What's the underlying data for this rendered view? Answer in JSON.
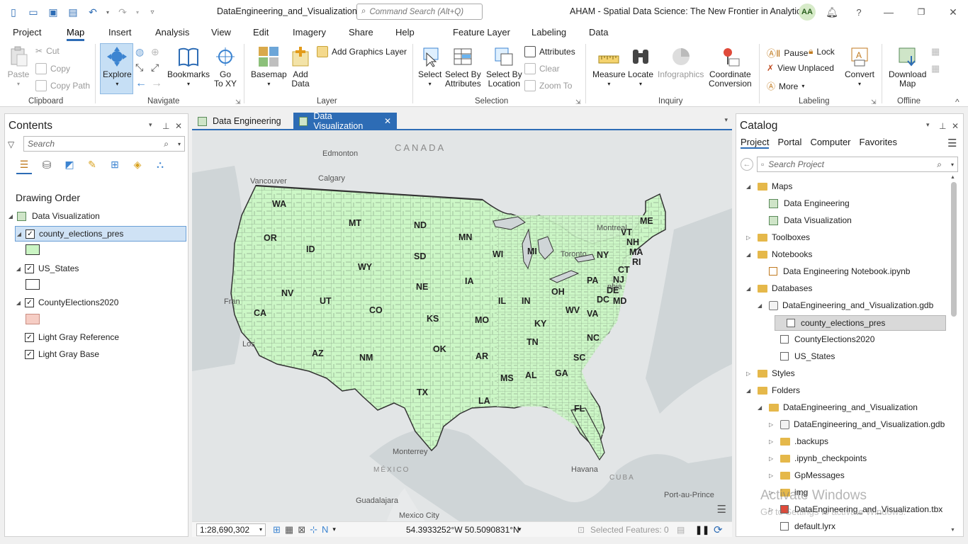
{
  "titlebar": {
    "document_title": "DataEngineering_and_Visualization",
    "command_search_placeholder": "Command Search (Alt+Q)",
    "project_title": "AHAM - Spatial Data Science:  The New Frontier in Analytics",
    "user_initials": "AA"
  },
  "ribbon_tabs": [
    "Project",
    "Map",
    "Insert",
    "Analysis",
    "View",
    "Edit",
    "Imagery",
    "Share",
    "Help"
  ],
  "contextual_tabs": [
    "Feature Layer",
    "Labeling",
    "Data"
  ],
  "ribbon": {
    "clipboard": {
      "label": "Clipboard",
      "paste": "Paste",
      "cut": "Cut",
      "copy": "Copy",
      "copy_path": "Copy Path"
    },
    "navigate": {
      "label": "Navigate",
      "explore": "Explore",
      "bookmarks": "Bookmarks",
      "go_to_xy": "Go\nTo XY"
    },
    "layer": {
      "label": "Layer",
      "basemap": "Basemap",
      "add_data": "Add\nData",
      "add_graphics_layer": "Add Graphics Layer"
    },
    "selection": {
      "label": "Selection",
      "select": "Select",
      "select_by_attributes": "Select By\nAttributes",
      "select_by_location": "Select By\nLocation",
      "attributes": "Attributes",
      "clear": "Clear",
      "zoom_to": "Zoom To"
    },
    "inquiry": {
      "label": "Inquiry",
      "measure": "Measure",
      "locate": "Locate",
      "infographics": "Infographics",
      "coordinate_conversion": "Coordinate\nConversion"
    },
    "labeling": {
      "label": "Labeling",
      "pause": "Pause",
      "lock": "Lock",
      "view_unplaced": "View Unplaced",
      "more": "More",
      "convert": "Convert"
    },
    "offline": {
      "label": "Offline",
      "download_map": "Download\nMap"
    }
  },
  "contents": {
    "title": "Contents",
    "search_placeholder": "Search",
    "drawing_order": "Drawing Order",
    "map_name": "Data Visualization",
    "layers": [
      {
        "name": "county_elections_pres",
        "checked": true,
        "swatch": "#cbf5c4"
      },
      {
        "name": "US_States",
        "checked": true,
        "swatch": "#ffffff"
      },
      {
        "name": "CountyElections2020",
        "checked": true,
        "swatch": "#f6cdc4"
      },
      {
        "name": "Light Gray Reference",
        "checked": true
      },
      {
        "name": "Light Gray Base",
        "checked": true
      }
    ]
  },
  "map_view": {
    "tabs": [
      {
        "label": "Data Engineering",
        "active": false
      },
      {
        "label": "Data Visualization",
        "active": true
      }
    ],
    "country_labels": [
      "CANADA",
      "MÉXICO",
      "CUBA"
    ],
    "city_labels": [
      "Edmonton",
      "Calgary",
      "Vancouver",
      "Montreal",
      "Toronto",
      "Monterrey",
      "Havana",
      "Guadalajara",
      "Mexico City",
      "Port-au-Prince",
      "Fran",
      "Los",
      "phia"
    ],
    "state_labels": [
      "WA",
      "OR",
      "CA",
      "ID",
      "NV",
      "MT",
      "WY",
      "UT",
      "AZ",
      "CO",
      "NM",
      "ND",
      "SD",
      "NE",
      "KS",
      "OK",
      "TX",
      "MN",
      "IA",
      "MO",
      "AR",
      "LA",
      "WI",
      "IL",
      "MS",
      "MI",
      "IN",
      "KY",
      "TN",
      "AL",
      "OH",
      "GA",
      "FL",
      "WV",
      "VA",
      "NC",
      "SC",
      "PA",
      "NY",
      "VT",
      "NH",
      "ME",
      "MA",
      "CT",
      "RI",
      "NJ",
      "DE",
      "MD",
      "DC"
    ],
    "fill_color": "#ccf7c6"
  },
  "statusbar": {
    "scale": "1:28,690,302",
    "coordinates": "54.3933252°W 50.5090831°N",
    "selected_features": "Selected Features: 0"
  },
  "catalog": {
    "title": "Catalog",
    "tabs": [
      "Project",
      "Portal",
      "Computer",
      "Favorites"
    ],
    "search_placeholder": "Search Project",
    "items": [
      {
        "label": "Maps",
        "level": 0,
        "type": "folder",
        "expanded": true
      },
      {
        "label": "Data Engineering",
        "level": 1,
        "type": "map"
      },
      {
        "label": "Data Visualization",
        "level": 1,
        "type": "map"
      },
      {
        "label": "Toolboxes",
        "level": 0,
        "type": "folder",
        "expanded": false
      },
      {
        "label": "Notebooks",
        "level": 0,
        "type": "folder",
        "expanded": true
      },
      {
        "label": "Data Engineering Notebook.ipynb",
        "level": 1,
        "type": "notebook"
      },
      {
        "label": "Databases",
        "level": 0,
        "type": "folder",
        "expanded": true
      },
      {
        "label": "DataEngineering_and_Visualization.gdb",
        "level": 1,
        "type": "gdb",
        "expanded": true
      },
      {
        "label": "county_elections_pres",
        "level": 2,
        "type": "fc",
        "selected": true
      },
      {
        "label": "CountyElections2020",
        "level": 2,
        "type": "fc"
      },
      {
        "label": "US_States",
        "level": 2,
        "type": "fc"
      },
      {
        "label": "Styles",
        "level": 0,
        "type": "folder",
        "expanded": false
      },
      {
        "label": "Folders",
        "level": 0,
        "type": "folder",
        "expanded": true
      },
      {
        "label": "DataEngineering_and_Visualization",
        "level": 1,
        "type": "folder",
        "expanded": true
      },
      {
        "label": "DataEngineering_and_Visualization.gdb",
        "level": 2,
        "type": "gdb",
        "expanded": false
      },
      {
        "label": ".backups",
        "level": 2,
        "type": "folder",
        "expanded": false
      },
      {
        "label": ".ipynb_checkpoints",
        "level": 2,
        "type": "folder",
        "expanded": false
      },
      {
        "label": "GpMessages",
        "level": 2,
        "type": "folder",
        "expanded": false
      },
      {
        "label": "img",
        "level": 2,
        "type": "folder",
        "expanded": false
      },
      {
        "label": "DataEngineering_and_Visualization.tbx",
        "level": 2,
        "type": "tbx",
        "expanded": false
      },
      {
        "label": "default.lyrx",
        "level": 2,
        "type": "file"
      }
    ]
  },
  "watermark": {
    "line1": "Activate Windows",
    "line2": "Go to Settings to activate Windows."
  }
}
